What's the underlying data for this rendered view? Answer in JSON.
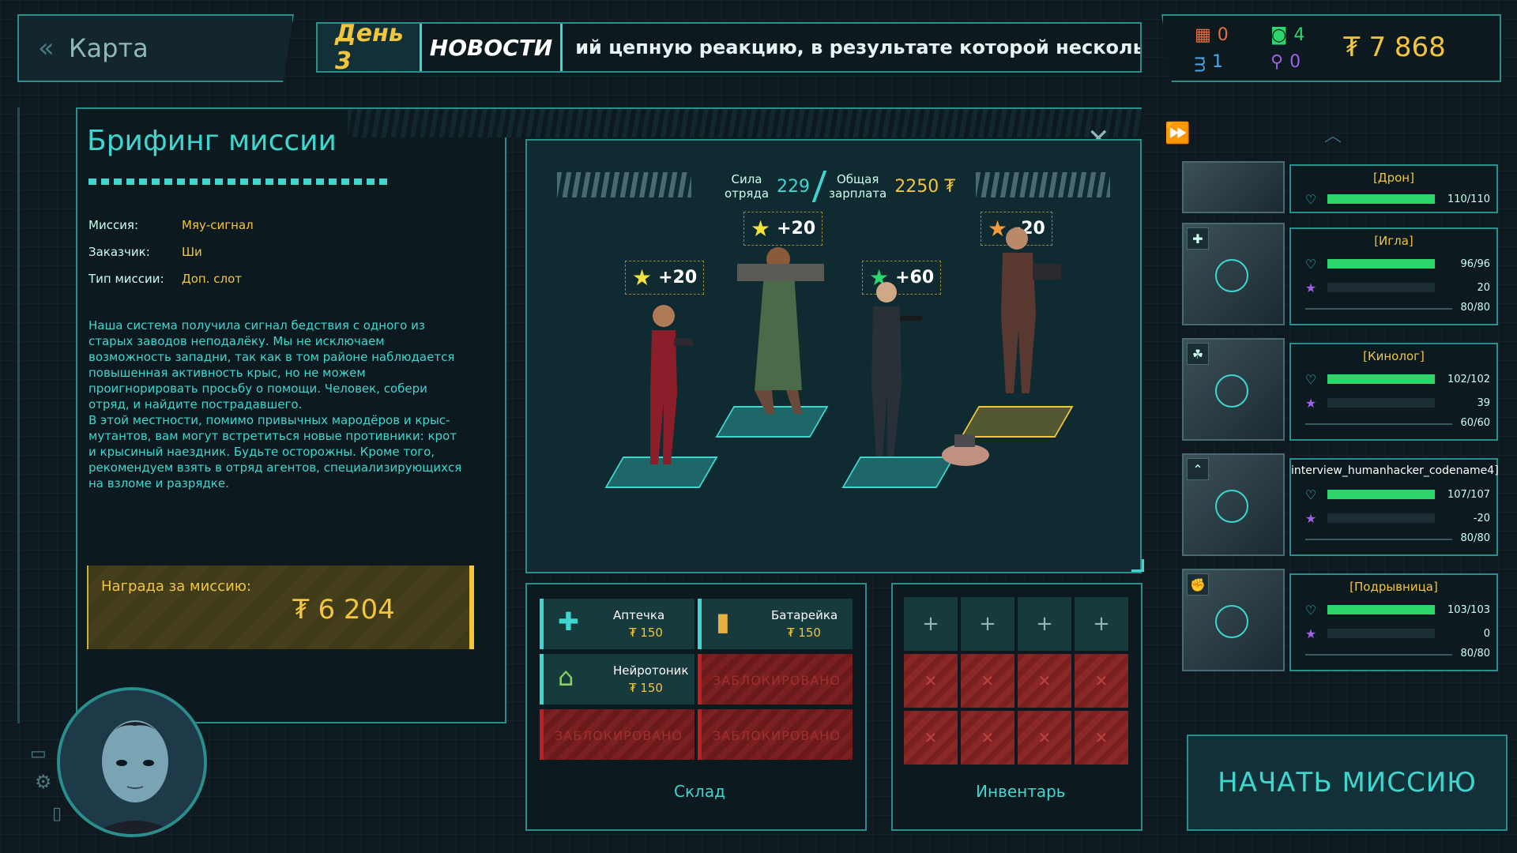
{
  "topbar": {
    "back_label": "Карта",
    "day": "День 3",
    "news_label": "НОВОСТИ",
    "ticker": "ий цепную реакцию, в результате которой несколько райс"
  },
  "resources": {
    "r1": "0",
    "r2": "4",
    "r3": "1",
    "r4": "0",
    "money": "₮ 7 868"
  },
  "briefing": {
    "title": "Брифинг миссии",
    "rows": [
      {
        "label": "Миссия:",
        "value": "Мяу-сигнал"
      },
      {
        "label": "Заказчик:",
        "value": "Ши"
      },
      {
        "label": "Тип миссии:",
        "value": "Доп. слот"
      }
    ],
    "desc1": "Наша система получила сигнал бедствия с одного из старых заводов неподалёку. Мы не исключаем возможность западни, так как в том районе наблюдается повышенная активность крыс, но не можем проигнорировать просьбу о помощи. Человек, собери отряд, и найдите пострадавшего.",
    "desc2": "В этой местности, помимо привычных мародёров и крыс-мутантов, вам могут встретиться новые противники: крот и крысиный наездник. Будьте осторожны. Кроме того, рекомендуем взять в отряд агентов, специализирующихся на взломе и разрядке.",
    "reward_label": "Награда за миссию:",
    "reward_value": "₮ 6 204"
  },
  "squad": {
    "power_label_1": "Сила",
    "power_label_2": "отряда",
    "power_value": "229",
    "salary_label_1": "Общая",
    "salary_label_2": "зарплата",
    "salary_value": "2250 ₮",
    "bonuses": [
      "+20",
      "+20",
      "+60",
      "-20"
    ]
  },
  "storage": {
    "label": "Склад",
    "items": [
      {
        "name": "Аптечка",
        "price": "₮ 150",
        "icon": "medkit-icon"
      },
      {
        "name": "Батарейка",
        "price": "₮ 150",
        "icon": "battery-icon"
      },
      {
        "name": "Нейротоник",
        "price": "₮ 150",
        "icon": "neurotonic-icon"
      }
    ],
    "locked_text": "ЗАБЛОКИРОВАНО"
  },
  "inventory": {
    "label": "Инвентарь"
  },
  "agents": [
    {
      "name": "[Дрон]",
      "hp": "110/110",
      "hp_frac": 1.0,
      "skill": "",
      "xp": ""
    },
    {
      "name": "[Игла]",
      "hp": "96/96",
      "hp_frac": 1.0,
      "skill": "20",
      "xp": "80/80"
    },
    {
      "name": "[Кинолог]",
      "hp": "102/102",
      "hp_frac": 1.0,
      "skill": "39",
      "xp": "60/60"
    },
    {
      "name": "interview_humanhacker_codename4]",
      "hp": "107/107",
      "hp_frac": 1.0,
      "skill": "-20",
      "xp": "80/80"
    },
    {
      "name": "[Подрывница]",
      "hp": "103/103",
      "hp_frac": 1.0,
      "skill": "0",
      "xp": "80/80"
    }
  ],
  "start_button": "НАЧАТЬ МИССИЮ",
  "colors": {
    "accent": "#3fd6d0",
    "gold": "#f2c53d",
    "hp": "#2bd66a",
    "locked": "#7a2020"
  }
}
